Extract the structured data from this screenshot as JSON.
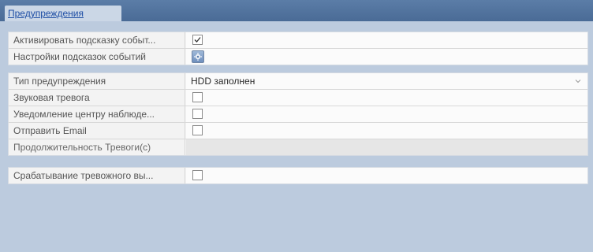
{
  "window": {
    "title": "Предупреждения"
  },
  "group1": {
    "rows": [
      {
        "label": "Активировать подсказку событ...",
        "type": "checkbox",
        "checked": true
      },
      {
        "label": "Настройки подсказок событий",
        "type": "settings-button",
        "icon": "gear-icon"
      }
    ]
  },
  "group2": {
    "rows": [
      {
        "label": "Тип предупреждения",
        "type": "select",
        "value": "HDD заполнен"
      },
      {
        "label": "Звуковая тревога",
        "type": "checkbox",
        "checked": false
      },
      {
        "label": "Уведомление центру наблюде...",
        "type": "checkbox",
        "checked": false
      },
      {
        "label": "Отправить Email",
        "type": "checkbox",
        "checked": false
      },
      {
        "label": "Продолжительность Тревоги(с)",
        "type": "disabled",
        "value": ""
      }
    ]
  },
  "group3": {
    "rows": [
      {
        "label": "Срабатывание тревожного вы...",
        "type": "checkbox",
        "checked": false
      }
    ]
  },
  "colors": {
    "background": "#bccbde",
    "titlebar": "#4a6b96",
    "title_link": "#1f4fa5"
  }
}
